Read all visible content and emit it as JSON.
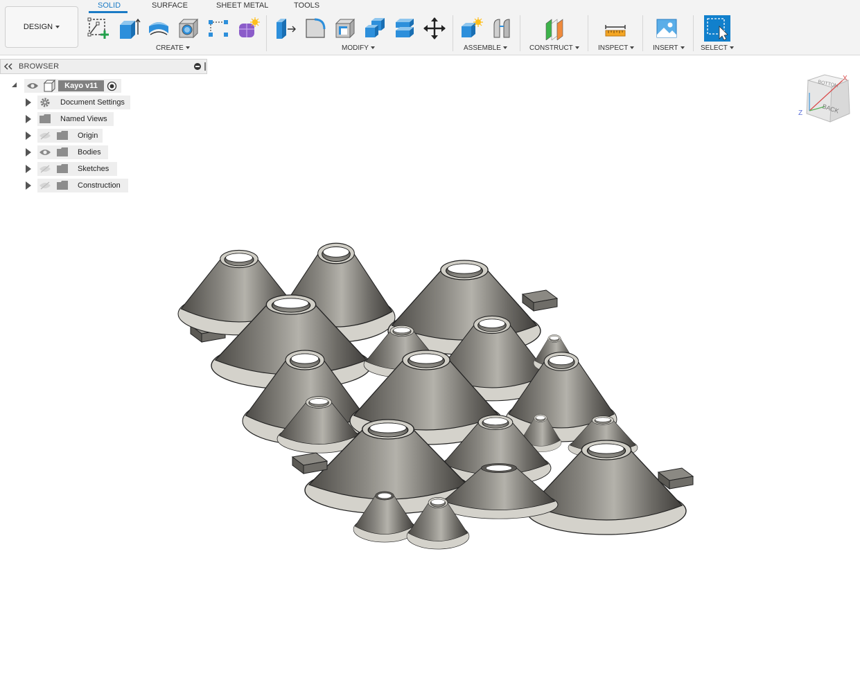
{
  "design_menu": {
    "label": "DESIGN"
  },
  "tabs": [
    {
      "label": "SOLID",
      "active": true
    },
    {
      "label": "SURFACE",
      "active": false
    },
    {
      "label": "SHEET METAL",
      "active": false
    },
    {
      "label": "TOOLS",
      "active": false
    }
  ],
  "groups": {
    "create": "CREATE",
    "modify": "MODIFY",
    "assemble": "ASSEMBLE",
    "construct": "CONSTRUCT",
    "inspect": "INSPECT",
    "insert": "INSERT",
    "select": "SELECT"
  },
  "tools": {
    "create": [
      "create-sketch-icon",
      "extrude-icon",
      "revolve-icon",
      "hole-icon",
      "pattern-icon",
      "create-form-icon"
    ],
    "modify": [
      "press-pull-icon",
      "fillet-icon",
      "shell-icon",
      "combine-icon",
      "offset-face-icon",
      "move-icon"
    ],
    "assemble": [
      "new-component-icon",
      "joint-icon"
    ],
    "construct": [
      "offset-plane-icon"
    ],
    "inspect": [
      "measure-icon"
    ],
    "insert": [
      "insert-image-icon"
    ],
    "select": [
      "select-icon"
    ]
  },
  "browser": {
    "title": "BROWSER",
    "root": "Kayo v11",
    "items": [
      {
        "label": "Document Settings",
        "icon": "gear-icon",
        "eye": "none"
      },
      {
        "label": "Named Views",
        "icon": "folder-icon",
        "eye": "none"
      },
      {
        "label": "Origin",
        "icon": "folder-icon",
        "eye": "hidden"
      },
      {
        "label": "Bodies",
        "icon": "folder-icon",
        "eye": "visible"
      },
      {
        "label": "Sketches",
        "icon": "folder-icon",
        "eye": "hidden"
      },
      {
        "label": "Construction",
        "icon": "folder-icon",
        "eye": "hidden"
      }
    ]
  },
  "viewcube": {
    "faces": [
      "BOTTOM",
      "BACK"
    ],
    "axes": [
      "X",
      "Z"
    ]
  },
  "colors": {
    "accent": "#1a7bc5",
    "select_bg": "#1180cc",
    "body": "#6e6c67"
  }
}
